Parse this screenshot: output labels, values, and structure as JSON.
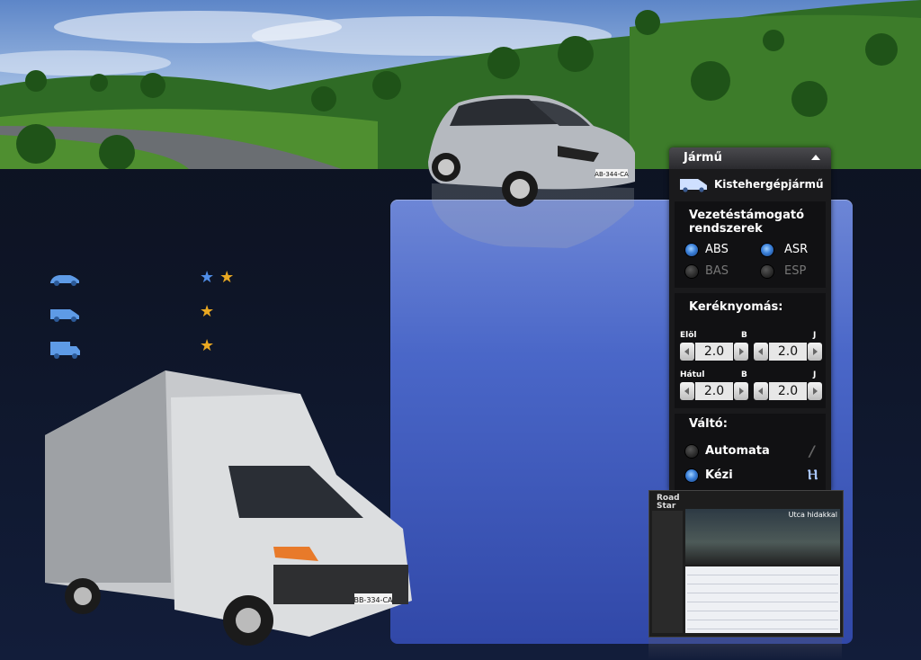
{
  "legend": [
    {
      "vehicle_icon": "car-icon",
      "stars": [
        "blue",
        "gold"
      ]
    },
    {
      "vehicle_icon": "van-icon",
      "stars": [
        "gold"
      ]
    },
    {
      "vehicle_icon": "truck-icon",
      "stars": [
        "gold"
      ]
    }
  ],
  "panel": {
    "title": "Jármű",
    "vehicle": {
      "icon": "van-icon",
      "label": "Kistehergépjármű"
    },
    "assist": {
      "title": "Vezetéstámogató rendszerek",
      "options": [
        {
          "label": "ABS",
          "on": true
        },
        {
          "label": "ASR",
          "on": true
        },
        {
          "label": "BAS",
          "on": false
        },
        {
          "label": "ESP",
          "on": false
        }
      ]
    },
    "tires": {
      "title": "Keréknyomás:",
      "front_label": "Elöl",
      "rear_label": "Hátul",
      "left_label": "B",
      "right_label": "J",
      "front_left": "2.0",
      "front_right": "2.0",
      "rear_left": "2.0",
      "rear_right": "2.0"
    },
    "gearbox": {
      "title": "Váltó:",
      "automatic_label": "Automata",
      "manual_label": "Kézi",
      "selected": "manual"
    }
  },
  "plates": {
    "car": "AB-344-CA",
    "truck": "BB-334-CA"
  },
  "thumbnail": {
    "logo_line1": "Road",
    "logo_line2": "Star",
    "caption": "Utca hidakkal"
  },
  "colors": {
    "accent_blue": "#3a7fd8",
    "star_gold": "#e9a822",
    "star_blue": "#4f8de8"
  }
}
